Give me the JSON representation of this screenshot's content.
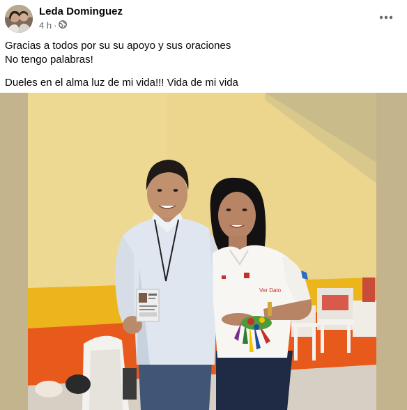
{
  "post": {
    "author": "Leda Dominguez",
    "time": "4 h",
    "separator": "·",
    "privacy_icon": "globe-icon",
    "more_icon": "more-horizontal-icon",
    "lines": [
      "Gracias a todos por su su apoyo y sus oraciones",
      "No tengo palabras!",
      "Dueles en el alma luz de mi vida!!! Vida de mi vida"
    ]
  },
  "photo": {
    "badge_text": "Ver Dato"
  },
  "colors": {
    "name": "#050505",
    "meta": "#65676b",
    "photo_backdrop": "#c4b48e",
    "wall": "#ecd58c",
    "wall_yellow_band": "#ebb51b",
    "wall_orange_band": "#e85a1c"
  }
}
